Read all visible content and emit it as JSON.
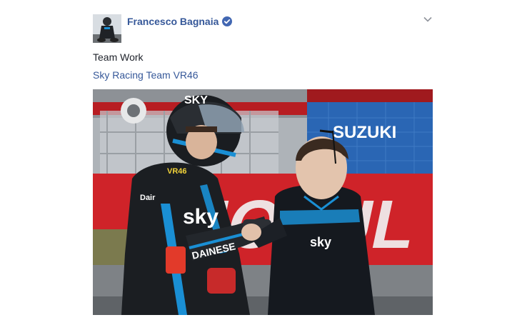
{
  "post": {
    "author_name": "Francesco Bagnaia",
    "text": "Team Work",
    "link_text": "Sky Racing Team VR46"
  },
  "photo": {
    "sponsor_banner": "SUZUKI",
    "wall_lettering": "MOTUL",
    "rider_helmet_text": "SKY",
    "rider_helmet_number": "VR46",
    "rider_suit_logo": "sky",
    "rider_sleeve_text": "DAINESE",
    "rider_chest_sponsor": "Dair",
    "engineer_jacket_logo": "sky"
  },
  "colors": {
    "author_link": "#365899",
    "body_text": "#1d2129",
    "verified_badge": "#4267b2",
    "chevron": "#90949c",
    "accent_red": "#d3262b",
    "sky_blue": "#1a8fd4"
  },
  "icons": {
    "verified": "verified-badge-icon",
    "menu": "chevron-down-icon"
  }
}
